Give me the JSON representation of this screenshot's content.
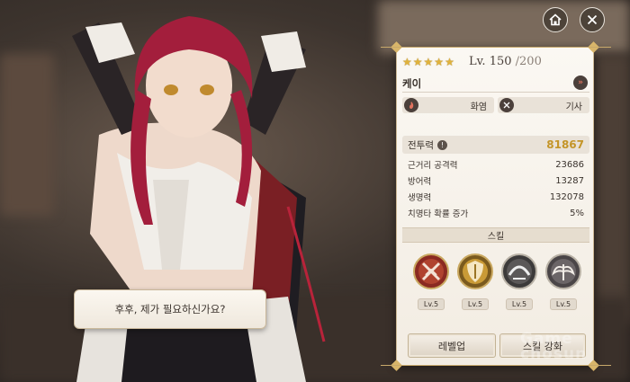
{
  "header": {
    "home_icon": "home-icon",
    "close_icon": "close-icon"
  },
  "dialog": {
    "text": "후후, 제가 필요하신가요?"
  },
  "character": {
    "stars": 5,
    "level_label": "Lv. 150",
    "level_max": "/200",
    "name": "케이",
    "element": "화염",
    "class": "기사"
  },
  "stats": {
    "power_label": "전투력",
    "power_value": "81867",
    "rows": [
      {
        "label": "근거리 공격력",
        "value": "23686"
      },
      {
        "label": "방어력",
        "value": "13287"
      },
      {
        "label": "생명력",
        "value": "132078"
      },
      {
        "label": "치명타 확률 증가",
        "value": "5%"
      }
    ]
  },
  "skills": {
    "header": "스킬",
    "items": [
      {
        "icon": "crossed-swords-skill-icon",
        "level": "Lv.5"
      },
      {
        "icon": "shield-skill-icon",
        "level": "Lv.5"
      },
      {
        "icon": "arc-skill-icon",
        "level": "Lv.5"
      },
      {
        "icon": "wings-skill-icon",
        "level": "Lv.5"
      }
    ]
  },
  "buttons": {
    "level_up": "레벨업",
    "skill_upgrade": "스킬 강화"
  },
  "watermark": {
    "line1": "Game",
    "line2": "chosun"
  },
  "colors": {
    "gold": "#c49528",
    "star": "#e0b23c",
    "fire": "#e1735f"
  }
}
